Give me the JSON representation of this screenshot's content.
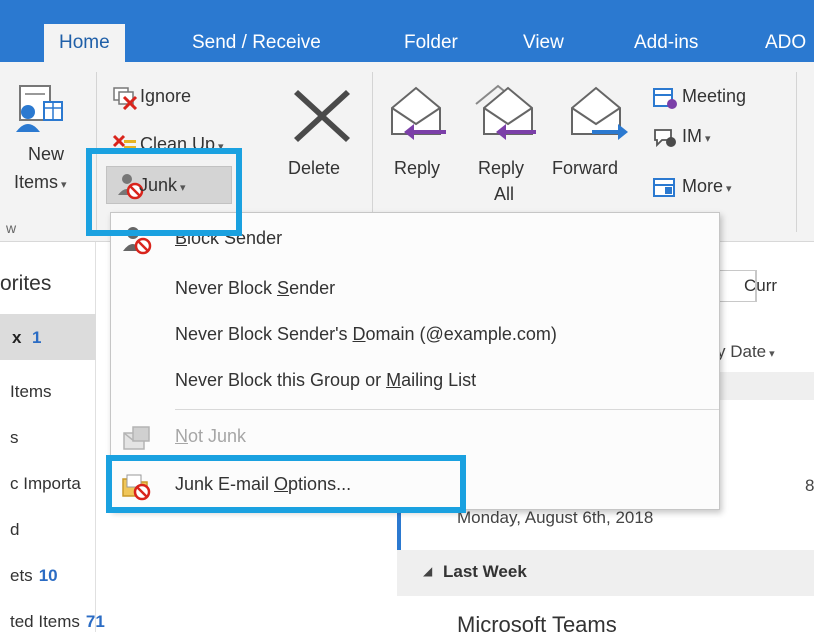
{
  "tabs": [
    "Home",
    "Send / Receive",
    "Folder",
    "View",
    "Add-ins",
    "ADO"
  ],
  "ribbon": {
    "new_items_line1": "New",
    "new_items_line2": "Items",
    "group_caption_fragment": "w",
    "ignore": "Ignore",
    "clean_up": "Clean Up",
    "junk": "Junk",
    "delete": "Delete",
    "reply": "Reply",
    "reply_all_line1": "Reply",
    "reply_all_line2": "All",
    "forward": "Forward",
    "meeting": "Meeting",
    "im": "IM",
    "more": "More"
  },
  "nav": {
    "header": "orites",
    "items": [
      {
        "label": "x",
        "count": "1"
      },
      {
        "label": "Items",
        "count": ""
      },
      {
        "label": "s",
        "count": ""
      },
      {
        "label": "c Importa",
        "count": ""
      },
      {
        "label": "d",
        "count": ""
      },
      {
        "label": "ets",
        "count": "10"
      },
      {
        "label": "ted Items",
        "count": "71"
      }
    ]
  },
  "mail": {
    "search_fragment": "Curr",
    "sort_fragment": "y Date",
    "date_line": "Monday, August 6th, 2018",
    "date_digit": "8",
    "last_week": "Last Week",
    "sender": "Microsoft Teams"
  },
  "menu": {
    "block_sender": {
      "before": "",
      "accel": "B",
      "after": "lock Sender"
    },
    "never_block_sender": {
      "before": "Never Block ",
      "accel": "S",
      "after": "ender"
    },
    "never_block_domain": {
      "before": "Never Block Sender's ",
      "accel": "D",
      "after": "omain (@example.com)"
    },
    "never_block_group": {
      "before": "Never Block this Group or ",
      "accel": "M",
      "after": "ailing List"
    },
    "not_junk": {
      "before": "",
      "accel": "N",
      "after": "ot Junk"
    },
    "options": {
      "before": "Junk E-mail ",
      "accel": "O",
      "after": "ptions..."
    }
  },
  "colors": {
    "tabbar": "#2b79d0",
    "highlight": "#1aa1e0",
    "ribbon": "#f3f3f3",
    "count_blue": "#2b6cc4",
    "block_red": "#d9241c"
  }
}
